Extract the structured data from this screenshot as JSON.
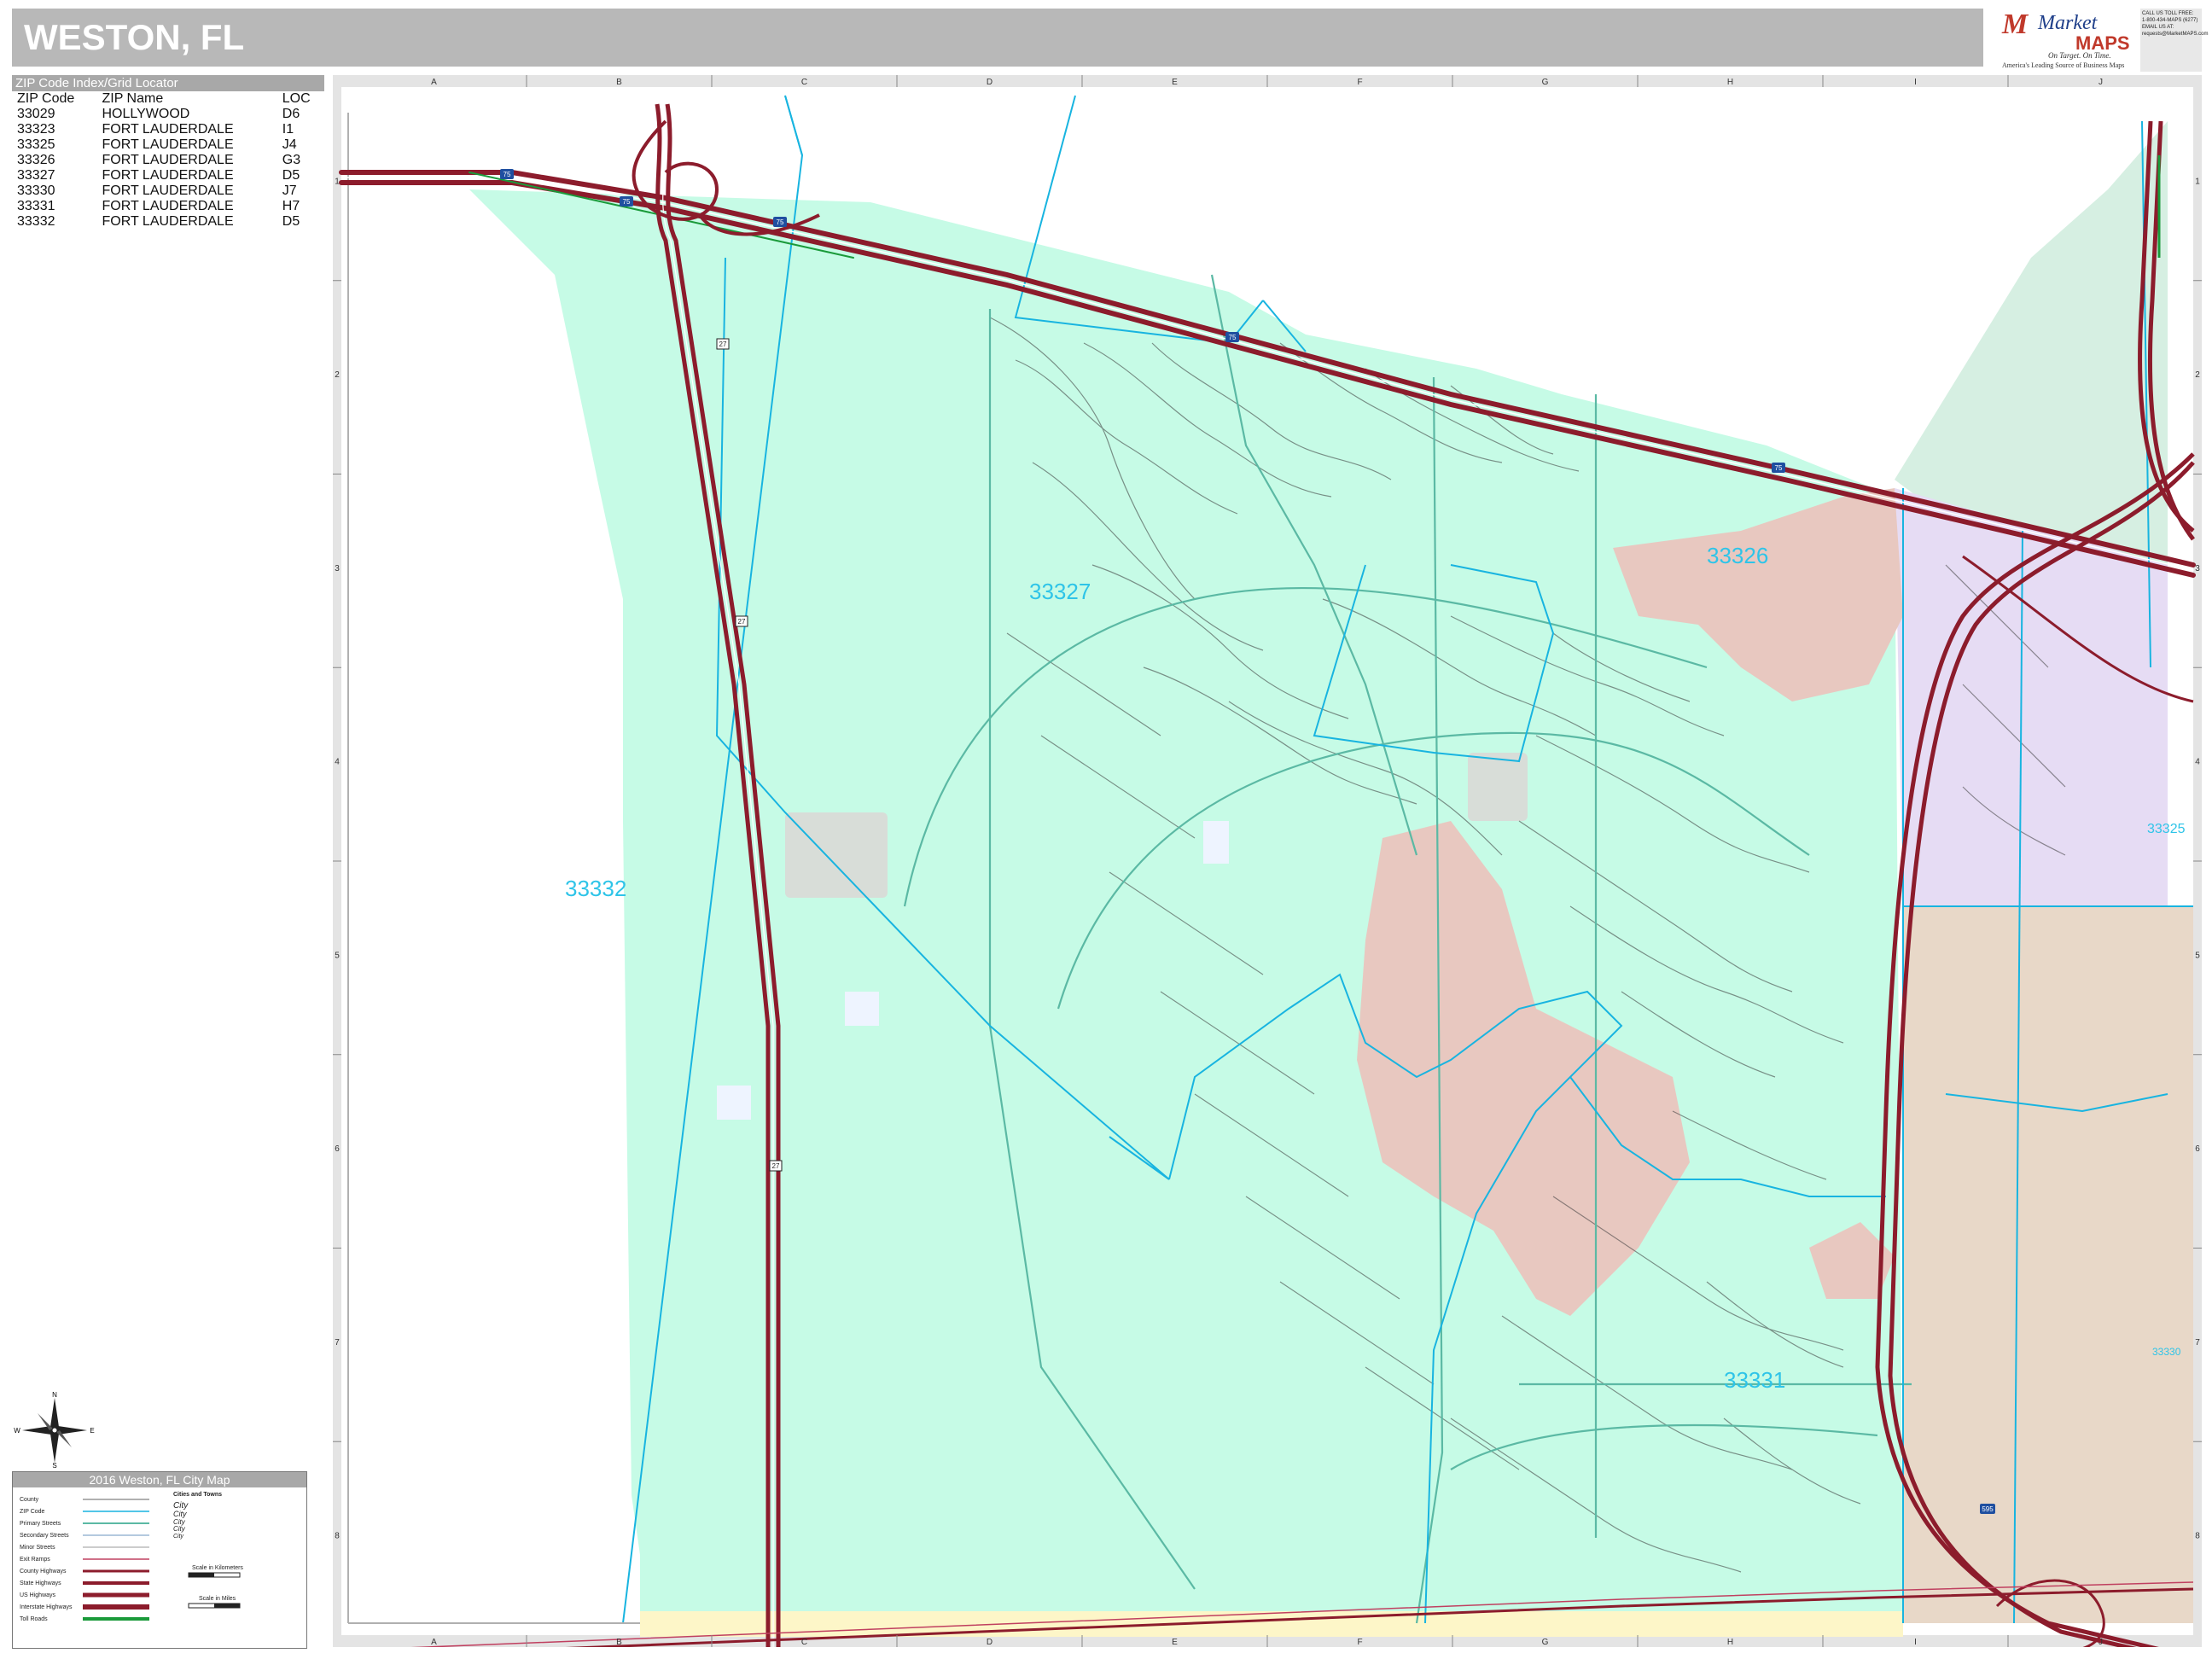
{
  "title": "WESTON, FL",
  "brand": {
    "name_top": "Market",
    "name_bottom": "MAPS",
    "tagline": "On Target. On Time.",
    "subtitle": "America's Leading Source of Business Maps",
    "contact_lines": [
      "CALL US TOLL FREE:",
      "1-800-434-MAPS (6277)",
      "EMAIL US AT:",
      "requests@MarketMAPS.com"
    ]
  },
  "zip_index": {
    "header": "ZIP Code Index/Grid Locator",
    "columns": [
      "ZIP Code",
      "ZIP Name",
      "LOC"
    ],
    "rows": [
      [
        "33029",
        "HOLLYWOOD",
        "D6"
      ],
      [
        "33323",
        "FORT LAUDERDALE",
        "I1"
      ],
      [
        "33325",
        "FORT LAUDERDALE",
        "J4"
      ],
      [
        "33326",
        "FORT LAUDERDALE",
        "G3"
      ],
      [
        "33327",
        "FORT LAUDERDALE",
        "D5"
      ],
      [
        "33330",
        "FORT LAUDERDALE",
        "J7"
      ],
      [
        "33331",
        "FORT LAUDERDALE",
        "H7"
      ],
      [
        "33332",
        "FORT LAUDERDALE",
        "D5"
      ]
    ]
  },
  "grid": {
    "columns": [
      "A",
      "B",
      "C",
      "D",
      "E",
      "F",
      "G",
      "H",
      "I",
      "J"
    ],
    "rows": [
      "1",
      "2",
      "3",
      "4",
      "5",
      "6",
      "7",
      "8"
    ]
  },
  "zip_labels": {
    "z33332": "33332",
    "z33327": "33327",
    "z33326": "33326",
    "z33331": "33331",
    "z33325": "33325",
    "z33330": "33330"
  },
  "road_shields": {
    "i75": "75",
    "us27": "27",
    "i595": "595"
  },
  "legend": {
    "header": "2016 Weston, FL City Map",
    "items": [
      "County",
      "ZIP Code",
      "Primary Streets",
      "Secondary Streets",
      "Minor Streets",
      "Exit Ramps",
      "County Highways",
      "State Highways",
      "US Highways",
      "Interstate Highways",
      "Toll Roads"
    ],
    "cities_header": "Cities and Towns",
    "cities": [
      "City",
      "City",
      "City",
      "City",
      "City"
    ],
    "scale_km": "Scale in Kilometers",
    "scale_mi": "Scale in Miles"
  },
  "compass": {
    "n": "N",
    "s": "S",
    "e": "E",
    "w": "W"
  },
  "colors": {
    "zip_33332": "#c6fbe6",
    "zip_33327": "#c6fbe6",
    "golf": "#e8c8c0",
    "zip_33325": "#e6dcf4",
    "zip_33330": "#e8d8c8",
    "south_strip": "#fdf6c8",
    "interstate": "#8c1c2c",
    "zip_border": "#18b4e0",
    "zip_label": "#2ec4e8"
  }
}
